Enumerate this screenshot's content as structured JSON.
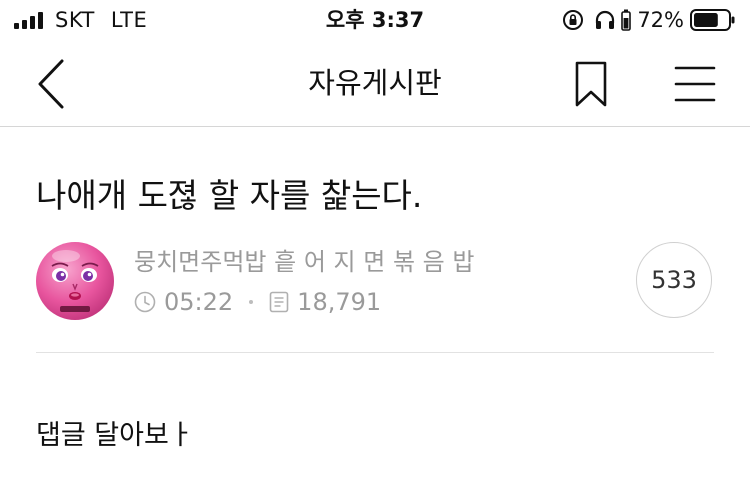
{
  "status_bar": {
    "carrier": "SKT",
    "network": "LTE",
    "time": "오후 3:37",
    "battery_percent": "72%",
    "battery_level": 0.72,
    "icons": [
      "signal-icon",
      "orientation-lock-icon",
      "headphones-icon",
      "battery-icon"
    ]
  },
  "nav": {
    "title": "자유게시판",
    "icons": [
      "back-chevron-icon",
      "bookmark-icon",
      "menu-icon"
    ]
  },
  "post": {
    "title": "나애개 도젾 할 자를 찵는다.",
    "author": "뭉치면주먹밥 흩 어 지 면 볶 음 밥",
    "time": "05:22",
    "views": "18,791",
    "comment_count": "533",
    "body": "댑글 달아보ㅏ",
    "icons": [
      "avatar-image",
      "clock-icon",
      "document-icon"
    ]
  },
  "colors": {
    "text": "#111111",
    "muted": "#9a9a9a",
    "divider": "#e2e2e2",
    "avatar_pink": "#e8559e"
  }
}
